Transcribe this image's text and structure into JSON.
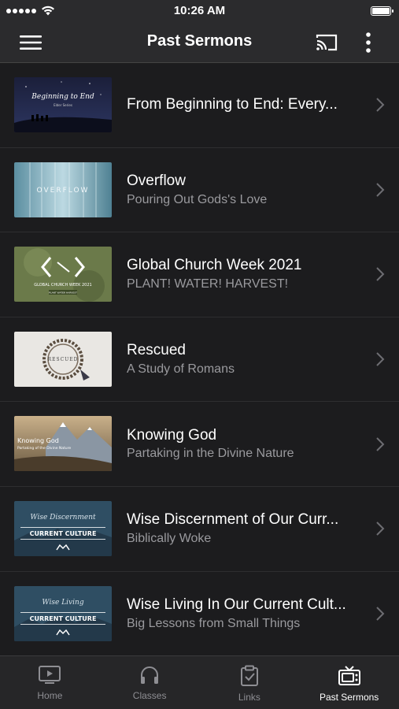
{
  "status_bar": {
    "time": "10:26 AM"
  },
  "header": {
    "title": "Past Sermons",
    "menu_icon": "hamburger-icon",
    "cast_icon": "cast-icon",
    "more_icon": "more-vertical-icon"
  },
  "sermons": [
    {
      "title": "From Beginning to End: Every...",
      "subtitle": "",
      "thumb_text": "Beginning to End",
      "thumb_caption": "Elder Series"
    },
    {
      "title": "Overflow",
      "subtitle": "Pouring Out Gods's Love",
      "thumb_text": "OVERFLOW",
      "thumb_caption": ""
    },
    {
      "title": "Global Church Week 2021",
      "subtitle": "PLANT! WATER! HARVEST!",
      "thumb_text": "GLOBAL CHURCH WEEK 2021",
      "thumb_caption": "PLANT WATER HARVEST"
    },
    {
      "title": "Rescued",
      "subtitle": "A Study of Romans",
      "thumb_text": "RESCUED",
      "thumb_caption": ""
    },
    {
      "title": "Knowing God",
      "subtitle": "Partaking in the Divine Nature",
      "thumb_text": "Knowing God",
      "thumb_caption": "Partaking of the Divine Nature"
    },
    {
      "title": "Wise Discernment of Our Curr...",
      "subtitle": "Biblically Woke",
      "thumb_text": "Wise Discernment",
      "thumb_caption": "CURRENT CULTURE"
    },
    {
      "title": "Wise Living In Our Current Cult...",
      "subtitle": "Big Lessons from Small Things",
      "thumb_text": "Wise Living",
      "thumb_caption": "CURRENT CULTURE"
    }
  ],
  "tabs": [
    {
      "label": "Home",
      "icon": "tv-play-icon",
      "active": false
    },
    {
      "label": "Classes",
      "icon": "headphones-icon",
      "active": false
    },
    {
      "label": "Links",
      "icon": "clipboard-check-icon",
      "active": false
    },
    {
      "label": "Past Sermons",
      "icon": "retro-tv-icon",
      "active": true
    }
  ],
  "colors": {
    "bar_bg": "#2b2b2d",
    "list_bg": "#1c1c1e",
    "subtitle": "#9a9a9e",
    "tab_inactive": "#8e8e93",
    "tab_active": "#ffffff"
  }
}
